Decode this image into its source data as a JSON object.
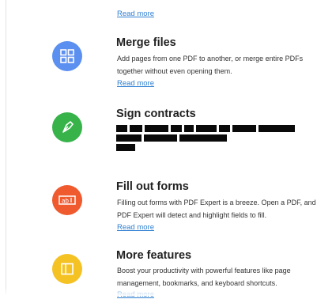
{
  "top_link": "Read more",
  "features": [
    {
      "title": "Merge files",
      "description": "Add pages from one PDF to another, or merge entire PDFs together without even opening them.",
      "link": "Read more",
      "icon": "grid-icon",
      "color": "#5b8ff0"
    },
    {
      "title": "Sign contracts",
      "description": "",
      "link": "",
      "icon": "pen-nib-icon",
      "color": "#37b34a",
      "redacted": true
    },
    {
      "title": "Fill out forms",
      "description": "Filling out forms with PDF Expert is a breeze. Open a PDF, and PDF Expert will detect and highlight fields to fill.",
      "link": "Read more",
      "icon": "form-field-icon",
      "color": "#ef5a2f"
    },
    {
      "title": "More features",
      "description": "Boost your productivity with powerful features like page management, bookmarks, and keyboard shortcuts.",
      "link": "Read more",
      "icon": "sidebar-panel-icon",
      "color": "#f5c223"
    }
  ]
}
